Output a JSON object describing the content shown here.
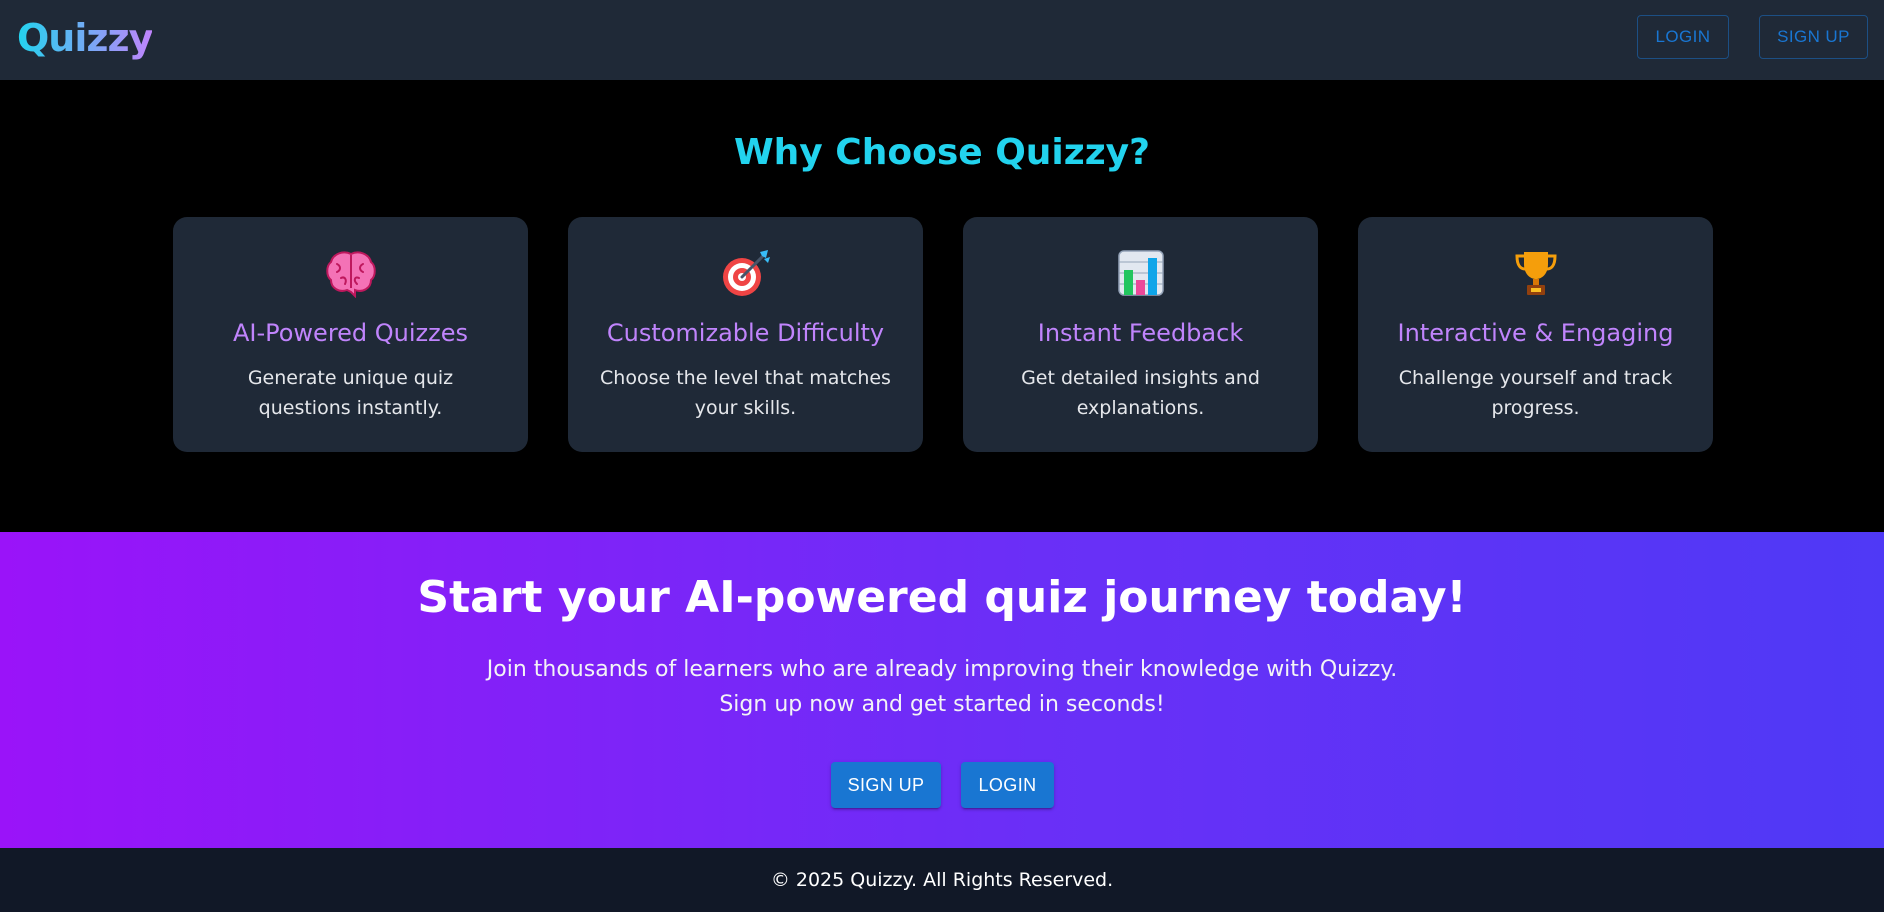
{
  "header": {
    "brand": "Quizzy",
    "login_label": "LOGIN",
    "signup_label": "SIGN UP"
  },
  "features": {
    "title": "Why Choose Quizzy?",
    "cards": [
      {
        "icon": "brain-icon",
        "title": "AI-Powered Quizzes",
        "description": "Generate unique quiz questions instantly."
      },
      {
        "icon": "target-icon",
        "title": "Customizable Difficulty",
        "description": "Choose the level that matches your skills."
      },
      {
        "icon": "bar-chart-icon",
        "title": "Instant Feedback",
        "description": "Get detailed insights and explanations."
      },
      {
        "icon": "trophy-icon",
        "title": "Interactive & Engaging",
        "description": "Challenge yourself and track progress."
      }
    ]
  },
  "cta": {
    "title": "Start your AI-powered quiz journey today!",
    "text_line1": "Join thousands of learners who are already improving their knowledge with Quizzy.",
    "text_line2": "Sign up now and get started in seconds!",
    "signup_label": "SIGN UP",
    "login_label": "LOGIN"
  },
  "footer": {
    "copyright": "© 2025 Quizzy. All Rights Reserved."
  },
  "colors": {
    "navbar": "#1f2937",
    "card": "#1f2937",
    "accent_cyan": "#22d3ee",
    "accent_purple": "#c084fc",
    "button_blue": "#1976d2",
    "footer": "#111827"
  }
}
